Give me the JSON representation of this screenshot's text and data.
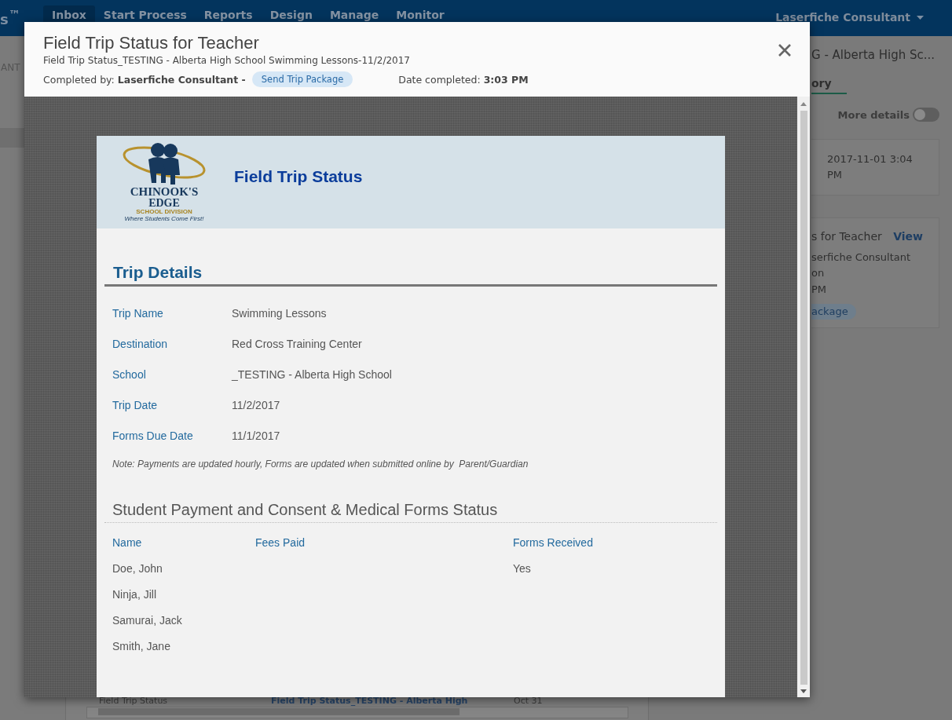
{
  "app": {
    "brand": "s$^{™}$",
    "nav": [
      {
        "label": "Inbox",
        "selected": true
      },
      {
        "label": "Start Process",
        "selected": false
      },
      {
        "label": "Reports",
        "selected": false
      },
      {
        "label": "Design",
        "selected": false
      },
      {
        "label": "Manage",
        "selected": false
      },
      {
        "label": "Monitor",
        "selected": false
      }
    ],
    "user": "Laserfiche Consultant",
    "left_fragment": "ANT",
    "right_panel": {
      "title": "G - Alberta High Sc...",
      "tab": "ory",
      "more_details": {
        "label": "More details",
        "on": false
      },
      "date_card": "2017-11-01 3:04 PM",
      "task_card": {
        "title": "s for Teacher",
        "link": "View",
        "line_1": "serfiche Consultant on",
        "line_2": "PM",
        "pill": "ackage"
      }
    },
    "bottom_row": [
      "Field Trip Status",
      "Field Trip Status_TESTING - Alberta High",
      "Oct 31"
    ]
  },
  "modal": {
    "title": "Field Trip Status for Teacher",
    "subtitle": "Field Trip Status_TESTING - Alberta High School Swimming Lessons-11/2/2017",
    "completed_by": "Completed by: **Laserfiche Consultant -**",
    "action": "Send Trip Package",
    "date_completed": "Date completed: **3:03 PM**"
  },
  "form": {
    "logo": {
      "name": "CHINOOK'S",
      "name_2": "EDGE",
      "division": "SCHOOL DIVISION",
      "tagline": "Where Students Come First!"
    },
    "title": "Field Trip Status",
    "section_title": "Trip Details",
    "fields": [
      {
        "label": "Trip Name",
        "value": "Swimming Lessons"
      },
      {
        "label": "Destination",
        "value": "Red Cross Training Center"
      },
      {
        "label": "School",
        "value": "_TESTING - Alberta High School"
      },
      {
        "label": "Trip Date",
        "value": "11/2/2017"
      },
      {
        "label": "Forms Due Date",
        "value": "11/1/2017"
      }
    ],
    "note": "Note: Payments are updated hourly, Forms are updated when submitted online by  Parent/Guardian",
    "table": {
      "title": "Student Payment and Consent & Medical Forms Status",
      "columns": [
        "Name",
        "Fees Paid",
        "Forms Received"
      ],
      "rows": [
        [
          "Doe, John",
          "",
          "Yes"
        ],
        [
          "Ninja, Jill",
          "",
          ""
        ],
        [
          "Samurai, Jack",
          "",
          ""
        ],
        [
          "Smith, Jane",
          "",
          ""
        ]
      ]
    }
  }
}
